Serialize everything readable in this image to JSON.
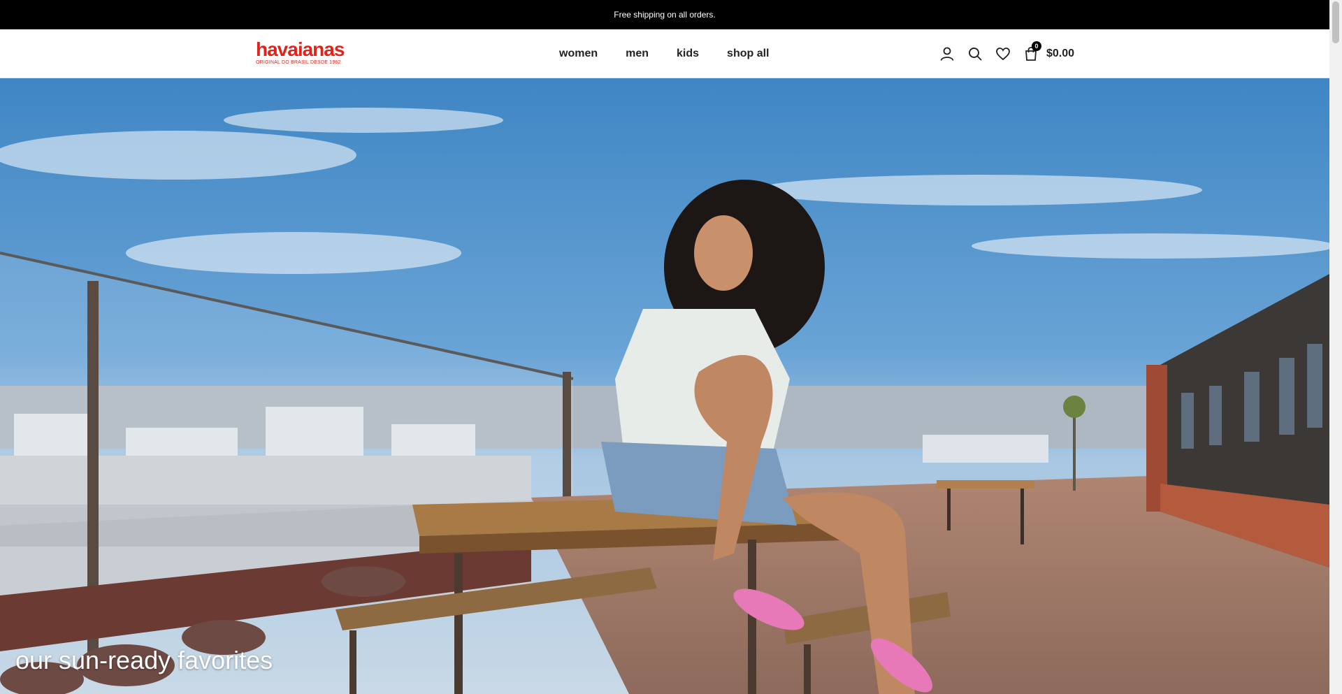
{
  "announcement": {
    "text": "Free shipping on all orders."
  },
  "header": {
    "logo": {
      "word": "havaianas",
      "tagline": "ORIGINAL DO BRASIL DESDE 1962"
    },
    "nav": [
      {
        "label": "women"
      },
      {
        "label": "men"
      },
      {
        "label": "kids"
      },
      {
        "label": "shop all"
      }
    ],
    "icons": [
      "account-icon",
      "search-icon",
      "wishlist-heart-icon",
      "cart-bag-icon"
    ],
    "cart": {
      "count": "0",
      "total": "$0.00"
    }
  },
  "hero": {
    "caption": "our sun-ready favorites",
    "image_description_icon": "hero-photo"
  },
  "colors": {
    "brand": "#e2231a",
    "topbar": "#000000",
    "text": "#222222"
  }
}
